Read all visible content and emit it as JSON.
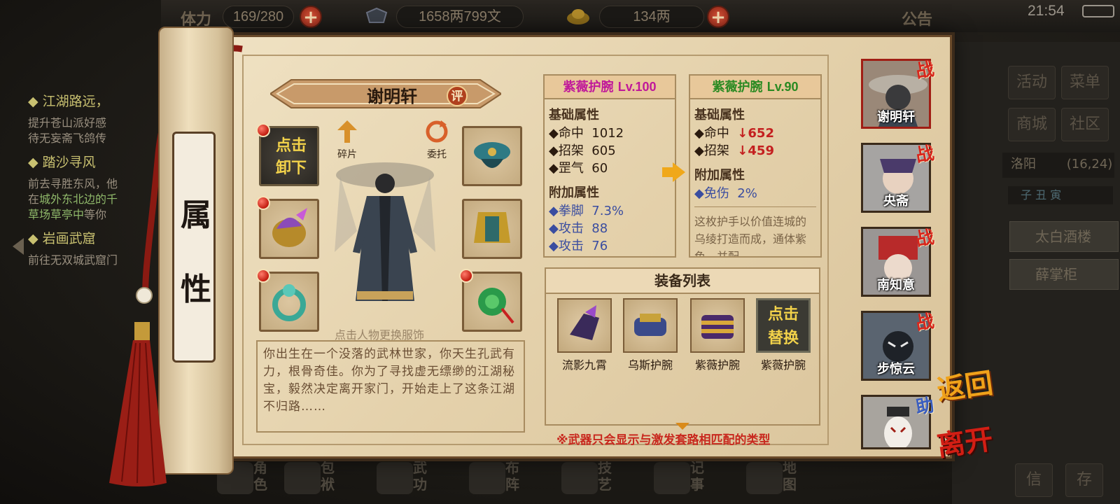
{
  "topbar": {
    "stamina_label": "体力",
    "stamina_value": "169/280",
    "money": "1658两799文",
    "gold": "134两",
    "notice_label": "公告",
    "clock": "21:54"
  },
  "quests": [
    {
      "title": "江湖路远，",
      "lines": [
        {
          "parts": [
            "提升苍山派好感"
          ]
        },
        {
          "parts": [
            "待无妄斋飞鸽传"
          ]
        }
      ]
    },
    {
      "title": "踏沙寻风",
      "lines": [
        {
          "parts": [
            "前去寻胜东风，他"
          ]
        },
        {
          "parts": [
            "在",
            "城外东北边的千"
          ]
        },
        {
          "parts": [
            "草场草亭中",
            "等你"
          ]
        }
      ]
    },
    {
      "title": "岩画武窟",
      "lines": [
        {
          "parts": [
            "前往无双城武窟门"
          ]
        }
      ]
    }
  ],
  "side_menu": [
    "活动",
    "菜单",
    "商城",
    "社区"
  ],
  "location": {
    "name": "洛阳",
    "coords": "(16,24)"
  },
  "time_marks": "子 丑 寅",
  "npcs": [
    "太白酒楼",
    "薛掌柜"
  ],
  "bottom_nav": [
    "角色",
    "包袱",
    "武功",
    "布阵",
    "技艺",
    "记事",
    "地图"
  ],
  "scroll_title": [
    "属",
    "性"
  ],
  "character": {
    "name": "谢明轩",
    "rate_badge": "评",
    "fragment_label": "碎片",
    "entrust_label": "委托",
    "hint": "点击人物更换服饰",
    "unload_line1": "点击",
    "unload_line2": "卸下",
    "story": "你出生在一个没落的武林世家，你天生孔武有力，根骨奇佳。你为了寻找虚无缥缈的江湖秘宝，毅然决定离开家门，开始走上了这条江湖不归路……"
  },
  "compare_left": {
    "name": "紫薇护腕",
    "level": "Lv.100",
    "name_color": "#c0189a",
    "base_title": "基础属性",
    "base": [
      {
        "label": "◆命中",
        "value": "1012"
      },
      {
        "label": "◆招架",
        "value": "605"
      },
      {
        "label": "◆罡气",
        "value": "60"
      }
    ],
    "extra_title": "附加属性",
    "extra": [
      {
        "label": "◆拳脚",
        "value": "7.3%"
      },
      {
        "label": "◆攻击",
        "value": "88"
      },
      {
        "label": "◆攻击",
        "value": "76"
      }
    ]
  },
  "compare_right": {
    "name": "紫薇护腕",
    "level": "Lv.90",
    "name_color": "#2a8a22",
    "base_title": "基础属性",
    "base": [
      {
        "label": "◆命中",
        "value": "652"
      },
      {
        "label": "◆招架",
        "value": "459"
      }
    ],
    "extra_title": "附加属性",
    "extra": [
      {
        "label": "◆免伤",
        "value": "2%"
      }
    ],
    "desc": "这枚护手以价值连城的乌绫打造而成，通体紫色，并配"
  },
  "equip_list": {
    "header": "装备列表",
    "items": [
      "流影九霄",
      "乌斯护腕",
      "紫薇护腕",
      "紫薇护腕"
    ],
    "replace_line1": "点击",
    "replace_line2": "替换",
    "notice": "※武器只会显示与激发套路相匹配的类型"
  },
  "party": [
    {
      "name": "谢明轩",
      "tag": "战"
    },
    {
      "name": "央斋",
      "tag": "战"
    },
    {
      "name": "南知意",
      "tag": "战"
    },
    {
      "name": "步惊云",
      "tag": "战"
    },
    {
      "name": "",
      "tag": "助"
    }
  ],
  "actions": {
    "return": "返回",
    "leave": "离开"
  },
  "colors": {
    "accent_red": "#c42020",
    "gold_text": "#f2d24a",
    "parchment": "#e4d1ab"
  }
}
